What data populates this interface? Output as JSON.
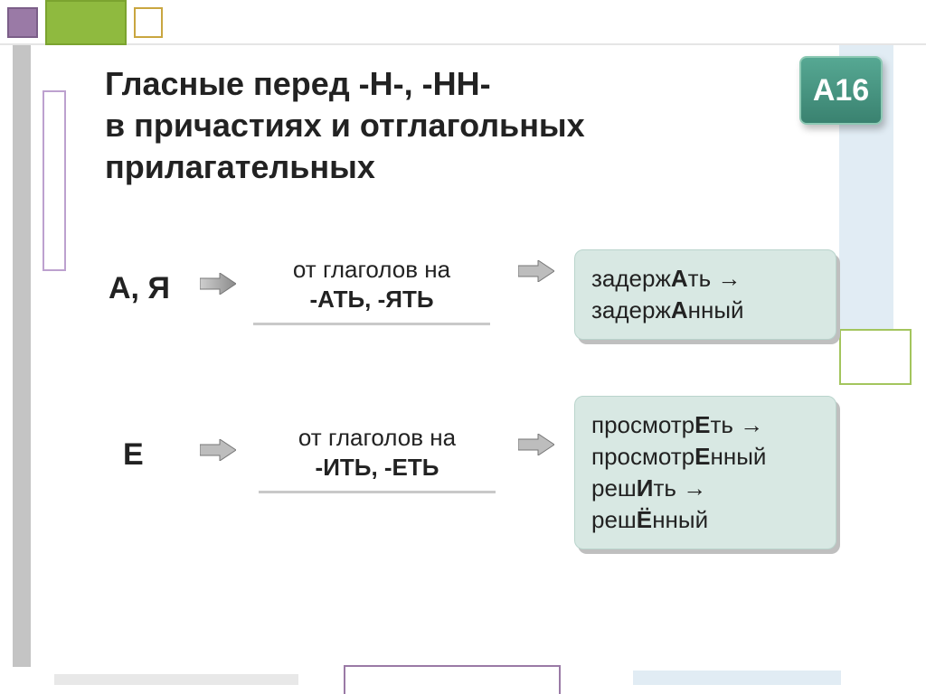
{
  "badge": "А16",
  "title_l1": "Гласные перед  -Н-, -НН-",
  "title_l2": "в причастиях и отглагольных",
  "title_l3": "прилагательных",
  "row_ay": {
    "letters": "А, Я",
    "rule_top": "от глаголов на",
    "rule_suf": "-АТЬ, -ЯТЬ",
    "ex_l1_pre": "задерж",
    "ex_l1_em": "А",
    "ex_l1_post": "ть →",
    "ex_l2_pre": "задерж",
    "ex_l2_em": "А",
    "ex_l2_post": "нный"
  },
  "row_e": {
    "letters": "Е",
    "rule_top": "от глаголов на",
    "rule_suf": "-ИТЬ, -ЕТЬ",
    "ex_l1_pre": "просмотр",
    "ex_l1_em": "Е",
    "ex_l1_post": "ть →",
    "ex_l2_pre": "просмотр",
    "ex_l2_em": "Е",
    "ex_l2_post": "нный",
    "ex_l3_pre": "реш",
    "ex_l3_em": "И",
    "ex_l3_post": "ть →",
    "ex_l4_pre": "реш",
    "ex_l4_em": "Ё",
    "ex_l4_post": "нный"
  }
}
